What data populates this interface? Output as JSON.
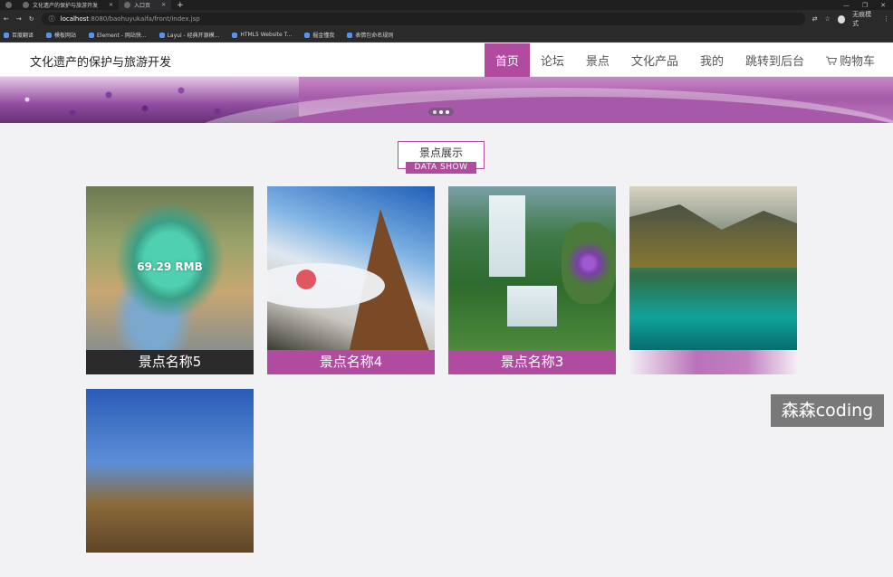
{
  "browser": {
    "tabs": [
      {
        "label": ""
      },
      {
        "label": "文化遗产的保护与旅游开发"
      },
      {
        "label": "入口页"
      }
    ],
    "new_tab": "+",
    "url_host": "localhost",
    "url_path": ":8080/baohuyukaifa/front/index.jsp",
    "profile_label": "无痕模式",
    "bookmarks": [
      "百度翻译",
      "模板网站",
      "Element - 网站快...",
      "Layui - 经典开源模...",
      "HTML5 Website T...",
      "掘金懂我",
      "表情包命名规则"
    ]
  },
  "header": {
    "site_title": "文化遗产的保护与旅游开发",
    "nav": [
      {
        "label": "首页",
        "active": true
      },
      {
        "label": "论坛"
      },
      {
        "label": "景点"
      },
      {
        "label": "文化产品"
      },
      {
        "label": "我的"
      },
      {
        "label": "跳转到后台"
      },
      {
        "label": "购物车"
      }
    ]
  },
  "section": {
    "title": "景点展示",
    "subtitle": "DATA SHOW"
  },
  "cards": [
    {
      "name": "景点名称5",
      "price": "69.29 RMB"
    },
    {
      "name": "景点名称4"
    },
    {
      "name": "景点名称3"
    },
    {
      "name": ""
    },
    {
      "name": ""
    }
  ],
  "watermark": "森森coding",
  "colors": {
    "accent": "#b04ba0"
  }
}
